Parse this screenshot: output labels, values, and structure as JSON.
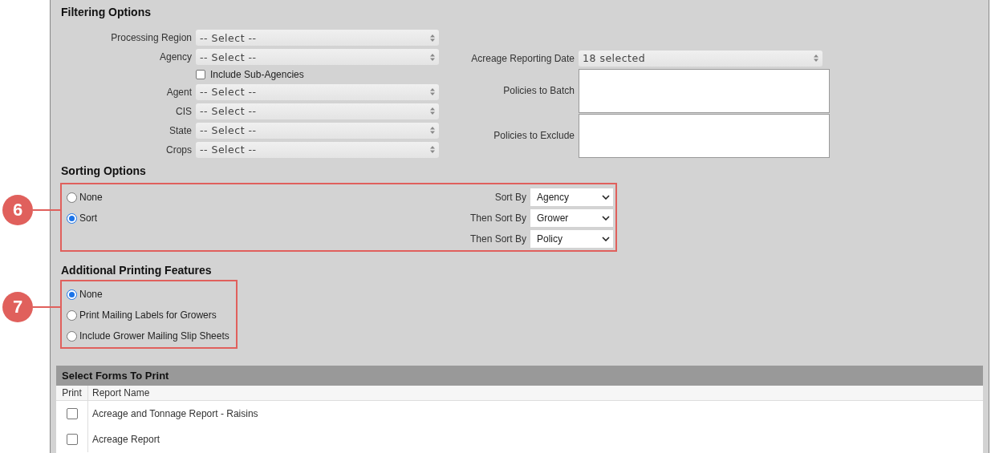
{
  "filtering": {
    "title": "Filtering Options",
    "left_fields": [
      {
        "kind": "select",
        "label": "Processing Region",
        "value": "-- Select --"
      },
      {
        "kind": "select",
        "label": "Agency",
        "value": "-- Select --"
      },
      {
        "kind": "checkbox",
        "label": "Include Sub-Agencies",
        "checked": false
      },
      {
        "kind": "select",
        "label": "Agent",
        "value": "-- Select --"
      },
      {
        "kind": "select",
        "label": "CIS",
        "value": "-- Select --"
      },
      {
        "kind": "select",
        "label": "State",
        "value": "-- Select --"
      },
      {
        "kind": "select",
        "label": "Crops",
        "value": "-- Select --"
      }
    ],
    "right_fields": [
      {
        "kind": "select",
        "label": "Acreage Reporting Date",
        "value": "18 selected"
      },
      {
        "kind": "textarea",
        "label": "Policies to Batch"
      },
      {
        "kind": "textarea",
        "label": "Policies to Exclude"
      }
    ]
  },
  "sorting": {
    "title": "Sorting Options",
    "callout": "6",
    "options": [
      {
        "label": "None",
        "selected": false
      },
      {
        "label": "Sort",
        "selected": true
      }
    ],
    "sort_fields": [
      {
        "label": "Sort By",
        "value": "Agency"
      },
      {
        "label": "Then Sort By",
        "value": "Grower"
      },
      {
        "label": "Then Sort By",
        "value": "Policy"
      }
    ]
  },
  "printing": {
    "title": "Additional Printing Features",
    "callout": "7",
    "options": [
      {
        "label": "None",
        "selected": true
      },
      {
        "label": "Print Mailing Labels for Growers",
        "selected": false
      },
      {
        "label": "Include Grower Mailing Slip Sheets",
        "selected": false
      }
    ]
  },
  "forms": {
    "title": "Select Forms To Print",
    "columns": [
      "Print",
      "Report Name"
    ],
    "rows": [
      {
        "checked": false,
        "name": "Acreage and Tonnage Report - Raisins"
      },
      {
        "checked": false,
        "name": "Acreage Report"
      }
    ]
  }
}
